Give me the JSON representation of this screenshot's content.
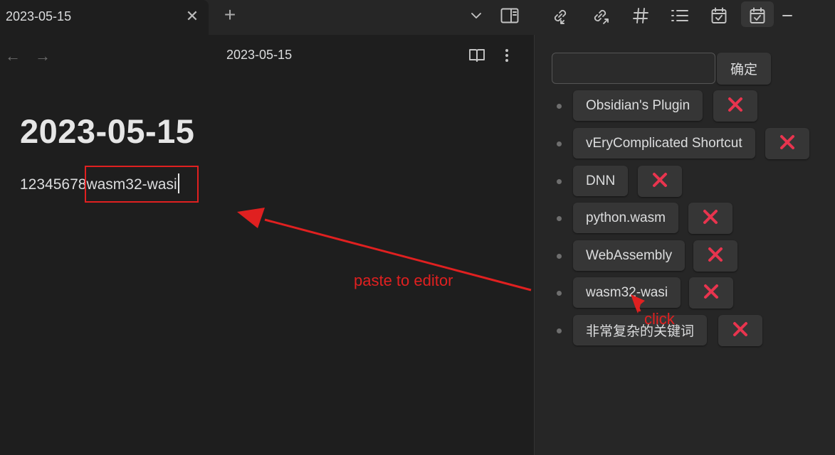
{
  "tab": {
    "title": "2023-05-15"
  },
  "toolbar": {
    "icons": [
      "close-icon",
      "plus-icon",
      "chevron-down-icon",
      "sidebar-toggle-icon",
      "backlinks-icon",
      "outgoing-links-icon",
      "tags-icon",
      "list-icon",
      "calendar-check-icon",
      "calendar-check-active-icon",
      "minimize-icon"
    ]
  },
  "editor": {
    "view_title": "2023-05-15",
    "heading": "2023-05-15",
    "body_prefix": "12345678",
    "body_pasted": "wasm32-wasi"
  },
  "sidebar": {
    "input_value": "",
    "confirm_label": "确定",
    "keywords": [
      {
        "label": "Obsidian's Plugin"
      },
      {
        "label": "vEryComplicated Shortcut"
      },
      {
        "label": "DNN"
      },
      {
        "label": "python.wasm"
      },
      {
        "label": "WebAssembly"
      },
      {
        "label": "wasm32-wasi"
      },
      {
        "label": "非常复杂的关键词"
      }
    ],
    "delete_color": "#e8344e"
  },
  "annotations": {
    "paste_label": "paste to editor",
    "click_label": "click",
    "color": "#e02020"
  }
}
